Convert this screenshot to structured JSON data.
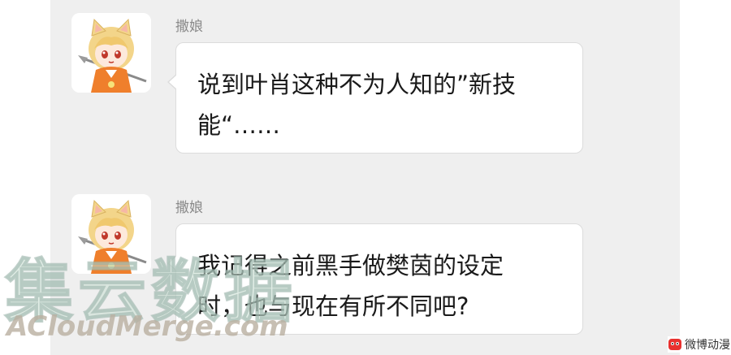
{
  "colors": {
    "panel_background": "#efefef",
    "bubble_background": "#ffffff",
    "bubble_border": "#dcdcdc",
    "sender_text": "#8a8a8a",
    "message_text": "#1a1a1a"
  },
  "messages": [
    {
      "sender": "撒娘",
      "avatar_icon": "anime-cat-girl-avatar",
      "lines": [
        "说到叶肖这种不为人知的”新技",
        "能“……"
      ]
    },
    {
      "sender": "撒娘",
      "avatar_icon": "anime-cat-girl-avatar",
      "lines": [
        "我记得之前黑手做樊茵的设定",
        "时，也与现在有所不同吧?"
      ]
    }
  ],
  "watermark": {
    "chinese_text": "集云数据",
    "english_text": "ACloudMerge.com"
  },
  "site_logo": {
    "icon": "weibo-comic-logo-icon",
    "text": "微博动漫"
  }
}
